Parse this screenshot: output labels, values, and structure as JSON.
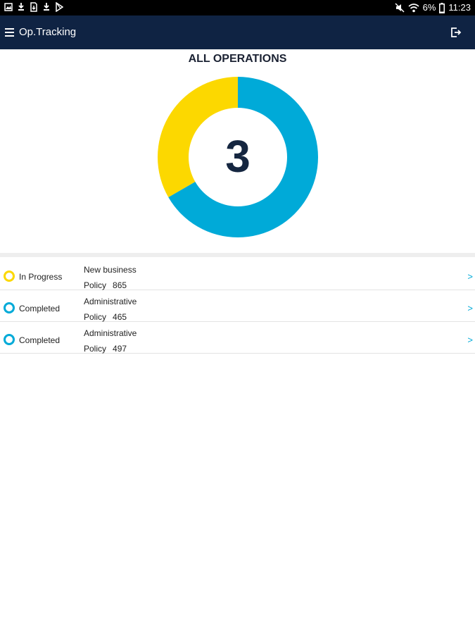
{
  "status_bar": {
    "battery": "6%",
    "time": "11:23",
    "left_icons": [
      "gallery-icon",
      "download-icon",
      "file-download-icon",
      "download-icon",
      "play-store-icon"
    ],
    "right_icons": [
      "mute-icon",
      "wifi-icon",
      "battery-icon"
    ]
  },
  "app_bar": {
    "title": "Op.Tracking",
    "menu_icon": "menu-icon",
    "logout_icon": "logout-icon",
    "background": "#0f2343"
  },
  "overview": {
    "title": "ALL OPERATIONS",
    "total": "3"
  },
  "chart_data": {
    "type": "pie",
    "categories": [
      "Completed",
      "In Progress"
    ],
    "values": [
      2,
      1
    ],
    "colors": [
      "#00aad8",
      "#fcd800"
    ],
    "center_label": "3"
  },
  "operations": [
    {
      "status": "In Progress",
      "status_color": "#fcd800",
      "type": "New business",
      "policy_label": "Policy",
      "policy_number": "865",
      "arrow": ">"
    },
    {
      "status": "Completed",
      "status_color": "#00aad8",
      "type": "Administrative",
      "policy_label": "Policy",
      "policy_number": "465",
      "arrow": ">"
    },
    {
      "status": "Completed",
      "status_color": "#00aad8",
      "type": "Administrative",
      "policy_label": "Policy",
      "policy_number": "497",
      "arrow": ">"
    }
  ]
}
